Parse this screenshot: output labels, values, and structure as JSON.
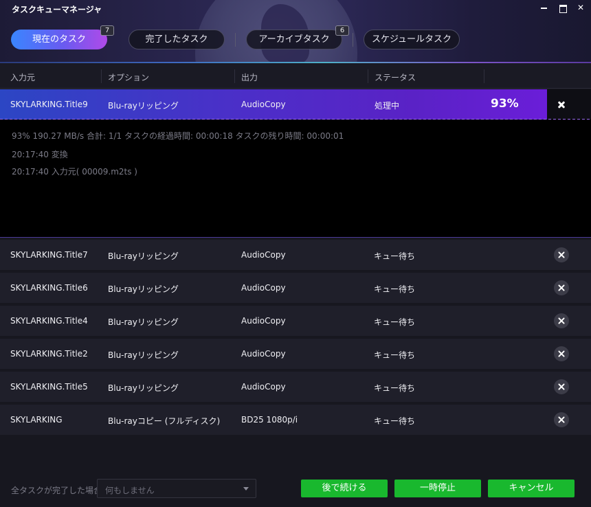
{
  "window": {
    "title": "タスクキューマネージャ"
  },
  "tabs": [
    {
      "label": "現在のタスク",
      "active": true,
      "badge": "7"
    },
    {
      "label": "完了したタスク",
      "active": false
    },
    {
      "label": "アーカイブタスク",
      "active": false,
      "badge": "6"
    },
    {
      "label": "スケジュールタスク",
      "active": false
    }
  ],
  "columns": [
    "入力元",
    "オプション",
    "出力",
    "ステータス"
  ],
  "active_task": {
    "source": "SKYLARKING.Title9",
    "option": "Blu-rayリッピング",
    "output": "AudioCopy",
    "status": "処理中",
    "percent": "93%",
    "progress": 0.93
  },
  "log": [
    "93%  190.27 MB/s   合計: 1/1  タスクの経過時間: 00:00:18  タスクの残り時間: 00:00:01",
    "20:17:40    変換",
    "20:17:40    入力元( 00009.m2ts )"
  ],
  "queue": [
    {
      "source": "SKYLARKING.Title7",
      "option": "Blu-rayリッピング",
      "output": "AudioCopy",
      "status": "キュー待ち"
    },
    {
      "source": "SKYLARKING.Title6",
      "option": "Blu-rayリッピング",
      "output": "AudioCopy",
      "status": "キュー待ち"
    },
    {
      "source": "SKYLARKING.Title4",
      "option": "Blu-rayリッピング",
      "output": "AudioCopy",
      "status": "キュー待ち"
    },
    {
      "source": "SKYLARKING.Title2",
      "option": "Blu-rayリッピング",
      "output": "AudioCopy",
      "status": "キュー待ち"
    },
    {
      "source": "SKYLARKING.Title5",
      "option": "Blu-rayリッピング",
      "output": "AudioCopy",
      "status": "キュー待ち"
    },
    {
      "source": "SKYLARKING",
      "option": "Blu-rayコピー (フルディスク)",
      "output": "BD25 1080p/i",
      "status": "キュー待ち"
    }
  ],
  "footer": {
    "label": "全タスクが完了した場合:",
    "select_value": "何もしません",
    "buttons": [
      "後で続ける",
      "一時停止",
      "キャンセル"
    ]
  },
  "colors": {
    "accent_green": "#19b82e",
    "active_row_start": "#2c46c4",
    "active_row_end": "#6a1ed8"
  },
  "icons": {
    "minimize": "minimize-icon",
    "maximize": "maximize-icon",
    "close": "close-icon",
    "remove": "remove-task-icon",
    "dropdown": "chevron-down-icon"
  }
}
